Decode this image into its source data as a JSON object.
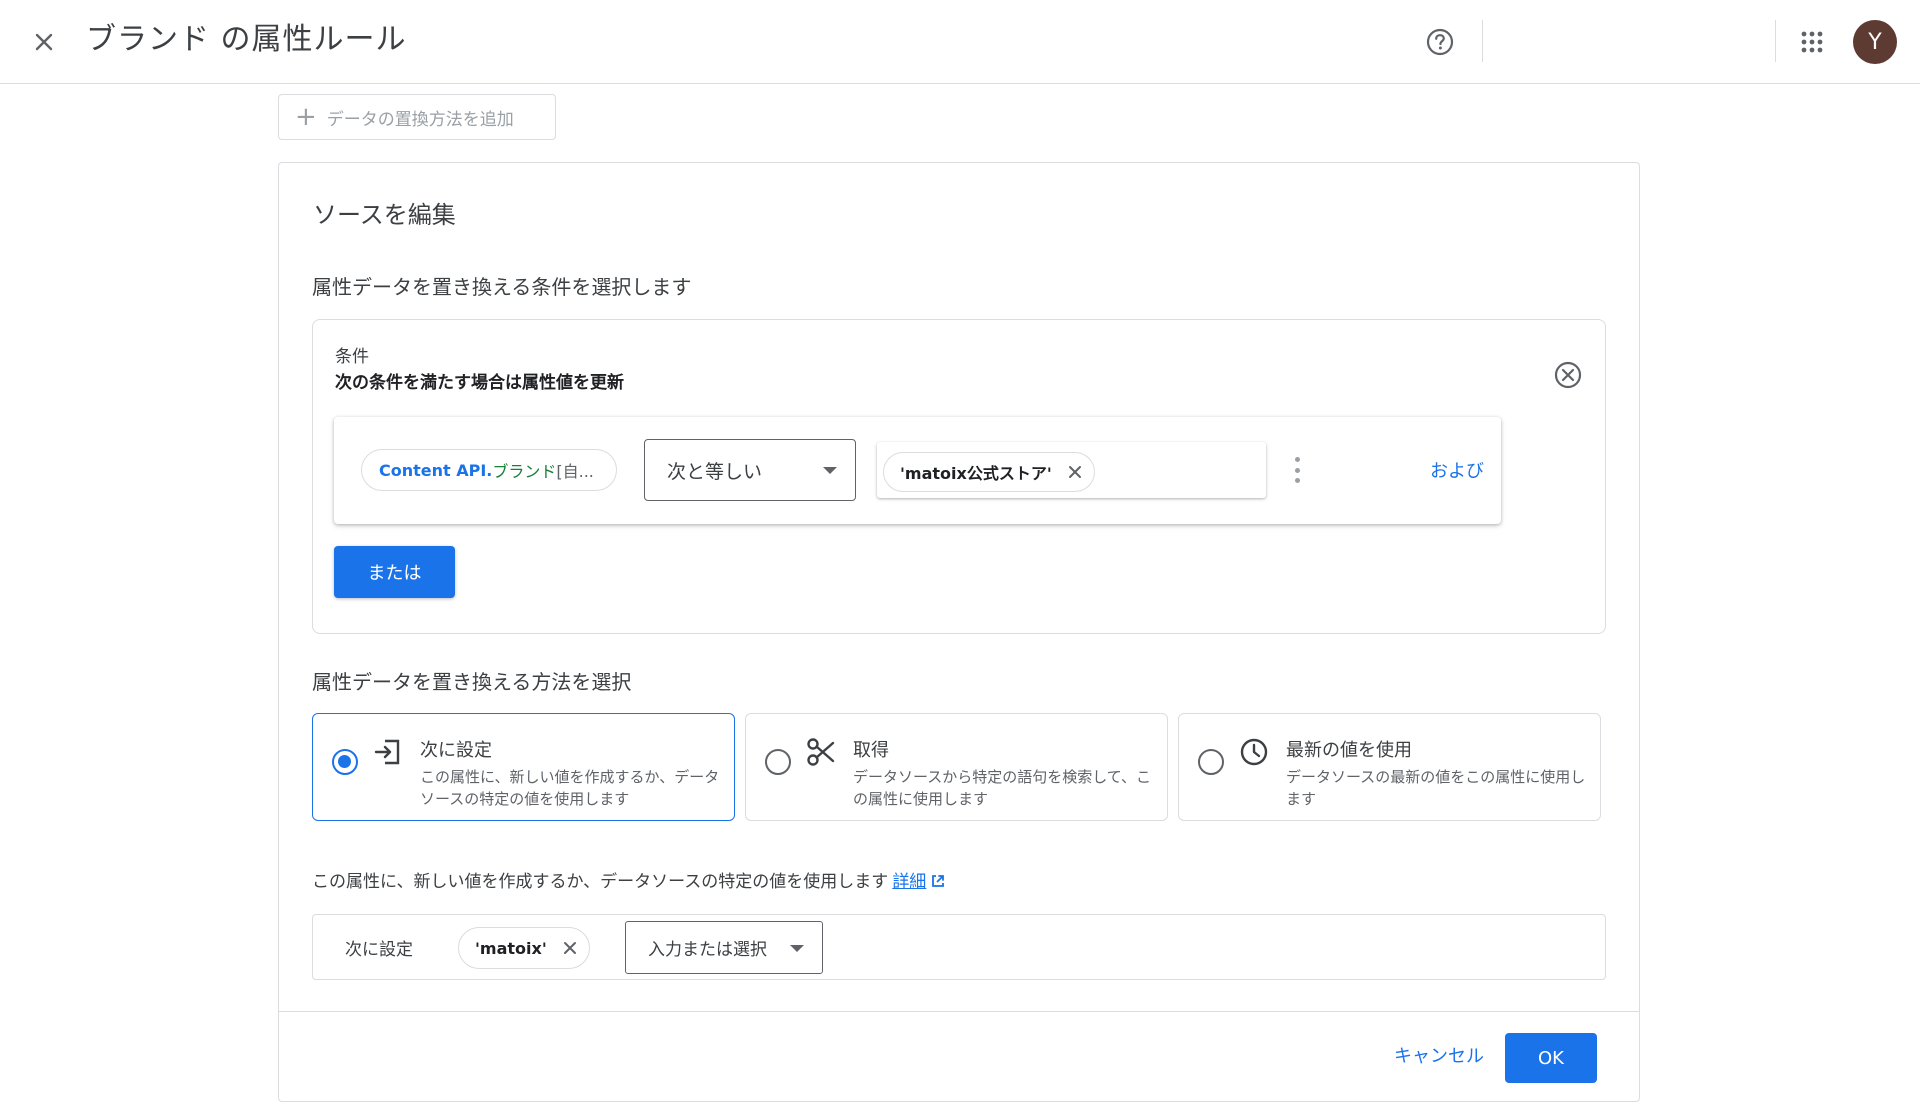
{
  "header": {
    "title": "ブランド の属性ルール",
    "avatar_initial": "Y"
  },
  "add_rule": {
    "label": "データの置換方法を追加"
  },
  "edit_source": {
    "title": "ソースを編集",
    "condition_section_label": "属性データを置き換える条件を選択します",
    "condition": {
      "label": "条件",
      "description": "次の条件を満たす場合は属性値を更新",
      "field_chip": {
        "source": "Content API.",
        "attribute": "ブランド",
        "rest": " [自..."
      },
      "operator": "次と等しい",
      "value_chip": "'matoix公式ストア'",
      "and_label": "および",
      "or_label": "または"
    },
    "method_section_label": "属性データを置き換える方法を選択",
    "methods": [
      {
        "title": "次に設定",
        "description": "この属性に、新しい値を作成するか、データソースの特定の値を使用します",
        "icon": "set-value-icon",
        "selected": true
      },
      {
        "title": "取得",
        "description": "データソースから特定の語句を検索して、この属性に使用します",
        "icon": "scissors-icon",
        "selected": false
      },
      {
        "title": "最新の値を使用",
        "description": "データソースの最新の値をこの属性に使用します",
        "icon": "clock-icon",
        "selected": false
      }
    ],
    "info_text": "この属性に、新しい値を作成するか、データソースの特定の値を使用します",
    "learn_more": "詳細",
    "set": {
      "label": "次に設定",
      "chip": "'matoix'",
      "select_placeholder": "入力または選択"
    }
  },
  "footer": {
    "cancel": "キャンセル",
    "ok": "OK"
  },
  "colors": {
    "accent": "#1a73e8",
    "attribute_green": "#188038",
    "avatar_bg": "#5d3a32",
    "border": "#dadce0"
  }
}
